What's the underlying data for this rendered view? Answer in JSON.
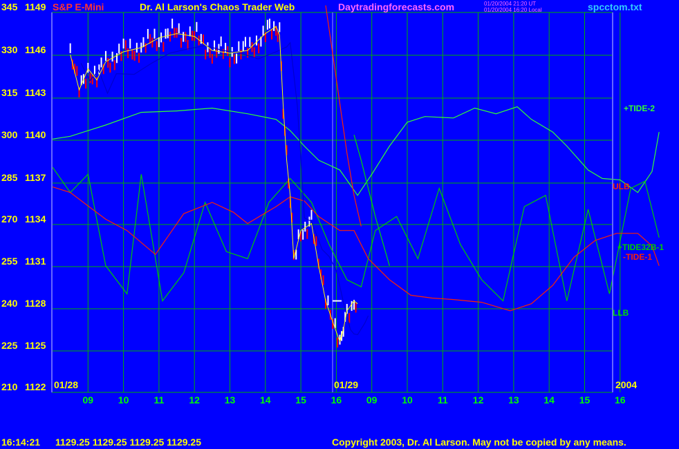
{
  "header": {
    "instrument": "S&P E-Mini",
    "title": "Dr. Al Larson's Chaos Trader Web",
    "site": "Daytradingforecasts.com",
    "stamp_ut": "01/20/2004 21:20 UT",
    "stamp_local": "01/20/2004 16:20 Local",
    "file": "spcctom.txt"
  },
  "footer": {
    "time": "16:14:21",
    "quote": "1129.25 1129.25 1129.25 1129.25",
    "copyright": "Copyright 2003, Dr. Al Larson. May not be copied by any means."
  },
  "colors": {
    "background": "#0000ff",
    "grid": "#00b000",
    "price_up": "#ffffff",
    "price_down": "#ff0000",
    "tide2": "#33ff33",
    "tide32b": "#00cc00",
    "tide1": "#ff2200",
    "ulb": "#ff2200",
    "llb": "#00dd00",
    "blue_ma": "#0000cc",
    "fit": "#ffff00"
  },
  "chart_data": {
    "type": "line",
    "title": "S&P E-Mini",
    "y_left_ticks": [
      "345",
      "330",
      "315",
      "300",
      "285",
      "270",
      "255",
      "240",
      "225",
      "210"
    ],
    "y_price_ticks": [
      "1149",
      "1146",
      "1143",
      "1140",
      "1137",
      "1134",
      "1131",
      "1128",
      "1125",
      "1122"
    ],
    "ylim": [
      1122,
      1149
    ],
    "x_ticks": [
      "09",
      "10",
      "11",
      "12",
      "13",
      "14",
      "15",
      "16",
      "09",
      "10",
      "11",
      "12",
      "13",
      "14",
      "15",
      "16"
    ],
    "date_labels": [
      "01/28",
      "01/29",
      "2004"
    ],
    "right_labels": [
      "+TIDE-2",
      "ULB",
      "+TIDE32B-1",
      "-TIDE-1",
      "LLB"
    ],
    "series": [
      {
        "name": "Price",
        "x": [
          8.0,
          8.25,
          8.5,
          8.75,
          9.0,
          9.5,
          10.0,
          10.5,
          11.0,
          11.5,
          12.0,
          12.5,
          13.0,
          13.5,
          13.8,
          13.9,
          14.0,
          14.1,
          14.2,
          14.3,
          14.5,
          14.8,
          15.0,
          15.2,
          15.4,
          15.6,
          15.7,
          15.8,
          16.0,
          16.1
        ],
        "values": [
          1146,
          1143.5,
          1145,
          1144.2,
          1145.5,
          1146.2,
          1146.5,
          1147.2,
          1147.5,
          1147.3,
          1146.3,
          1146.1,
          1146.3,
          1147.5,
          1148.0,
          1147.4,
          1142.5,
          1138.5,
          1136.0,
          1131.5,
          1133.5,
          1134.0,
          1131.0,
          1128.5,
          1127.0,
          1125.6,
          1126.5,
          1127.8,
          1128.5,
          1128.3
        ]
      },
      {
        "name": "+TIDE-2",
        "x": [
          7.5,
          8.0,
          9.0,
          10.0,
          11.0,
          12.0,
          13.0,
          13.8,
          14.2,
          14.6,
          15.0,
          15.6,
          16.1,
          16.5,
          17.0,
          17.5,
          18.0,
          18.8,
          19.4,
          20.0,
          20.6,
          21.0,
          21.6,
          22.0,
          22.6,
          23.0,
          23.5,
          24.0,
          24.4,
          24.6
        ],
        "values": [
          1140,
          1140.2,
          1141,
          1141.9,
          1142.0,
          1142.2,
          1141.8,
          1141.4,
          1140.6,
          1139.5,
          1138.5,
          1137.8,
          1136.0,
          1137.5,
          1139.5,
          1141.2,
          1141.6,
          1141.5,
          1142.2,
          1141.8,
          1142.3,
          1141.4,
          1140.5,
          1139.5,
          1137.8,
          1137.2,
          1137.1,
          1136.2,
          1137.7,
          1140.5
        ]
      },
      {
        "name": "+TIDE32B-1",
        "x": [
          7.5,
          8.0,
          8.5,
          9.0,
          9.6,
          10.0,
          10.6,
          11.2,
          11.8,
          12.4,
          13.0,
          13.6,
          14.2,
          14.8,
          15.3,
          15.8,
          16.2,
          16.6,
          17.2,
          17.8,
          18.4,
          19.0,
          19.6,
          20.2,
          20.8,
          21.4,
          22.0,
          22.6,
          23.2,
          23.8,
          24.2,
          24.6
        ],
        "values": [
          1138,
          1136.2,
          1137.5,
          1131.0,
          1129.0,
          1137.5,
          1128.5,
          1130.5,
          1135.5,
          1132.0,
          1131.5,
          1135.5,
          1137.2,
          1135.5,
          1132.5,
          1130.0,
          1129.5,
          1133.5,
          1134.5,
          1131.5,
          1136.5,
          1132.5,
          1130.0,
          1128.5,
          1135.2,
          1136.0,
          1128.5,
          1135.0,
          1129.0,
          1136.5,
          1137.0,
          1133.0
        ]
      },
      {
        "name": "-TIDE-1",
        "x": [
          7.5,
          8.0,
          9.0,
          9.6,
          10.4,
          11.2,
          12.0,
          12.6,
          13.0,
          13.8,
          14.2,
          14.6,
          15.0,
          15.6,
          16.0,
          16.4,
          17.0,
          17.6,
          18.2,
          18.8,
          19.6,
          20.4,
          21.0,
          21.6,
          22.2,
          22.8,
          23.4,
          24.0,
          24.4,
          24.6
        ],
        "values": [
          1136.6,
          1136.2,
          1134.3,
          1133.5,
          1131.8,
          1134.7,
          1135.5,
          1134.8,
          1134.0,
          1135.2,
          1135.9,
          1135.6,
          1134.5,
          1133.5,
          1133.5,
          1131.5,
          1130.0,
          1128.9,
          1128.7,
          1128.6,
          1128.4,
          1127.8,
          1128.3,
          1129.6,
          1131.6,
          1132.8,
          1133.3,
          1133.3,
          1132.4,
          1131.0
        ]
      },
      {
        "name": "ULB",
        "x": [
          15.2,
          15.4,
          15.8,
          16.0,
          16.2
        ],
        "values": [
          1149.5,
          1146.0,
          1139.0,
          1136.0,
          1133.8
        ]
      },
      {
        "name": "LLB",
        "x": [
          16.0,
          16.2,
          16.6,
          17.0
        ],
        "values": [
          1140.3,
          1138.5,
          1134.5,
          1131.0
        ]
      }
    ]
  }
}
